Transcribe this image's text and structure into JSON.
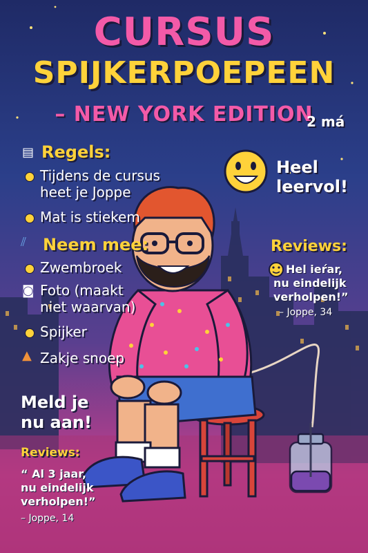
{
  "header": {
    "title_line1": "CURSUS",
    "title_line2": "SPIJKERPOEPEEN",
    "title_line3": "– NEW YORK EDITION",
    "duration": "2 má"
  },
  "rules": {
    "heading": "Regels:",
    "items": [
      {
        "line1": "Tijdens de cursus",
        "line2": "heet je Joppe"
      },
      {
        "line1": "Mat is stiekem",
        "line2": ""
      }
    ]
  },
  "bring": {
    "heading": "Neem mee:",
    "items": [
      {
        "line1": "Zwembroek",
        "line2": ""
      },
      {
        "line1": "Foto (maakt",
        "line2": "niet waarvan)"
      },
      {
        "line1": "Spijker",
        "line2": ""
      },
      {
        "line1": "Zakje snoep",
        "line2": ""
      }
    ]
  },
  "badge": {
    "line1": "Heel",
    "line2": "leervol!"
  },
  "reviews_right": {
    "heading": "Reviews:",
    "line1": "Hel ieŕar,",
    "line2": "nu eindelijk",
    "line3": "verholpen!”",
    "author": "– Joppe, 34"
  },
  "cta": {
    "line1": "Meld je",
    "line2": "nu aan!"
  },
  "reviews_left": {
    "heading": "Reviews:",
    "line1": "“ Al 3 jaar,",
    "line2": "nu eindelijk",
    "line3": "verholpen!”",
    "author": "– Joppe, 14"
  },
  "colors": {
    "pink": "#f35aa8",
    "yellow": "#ffd23a",
    "white": "#ffffff",
    "outline": "#1a1a3a"
  }
}
